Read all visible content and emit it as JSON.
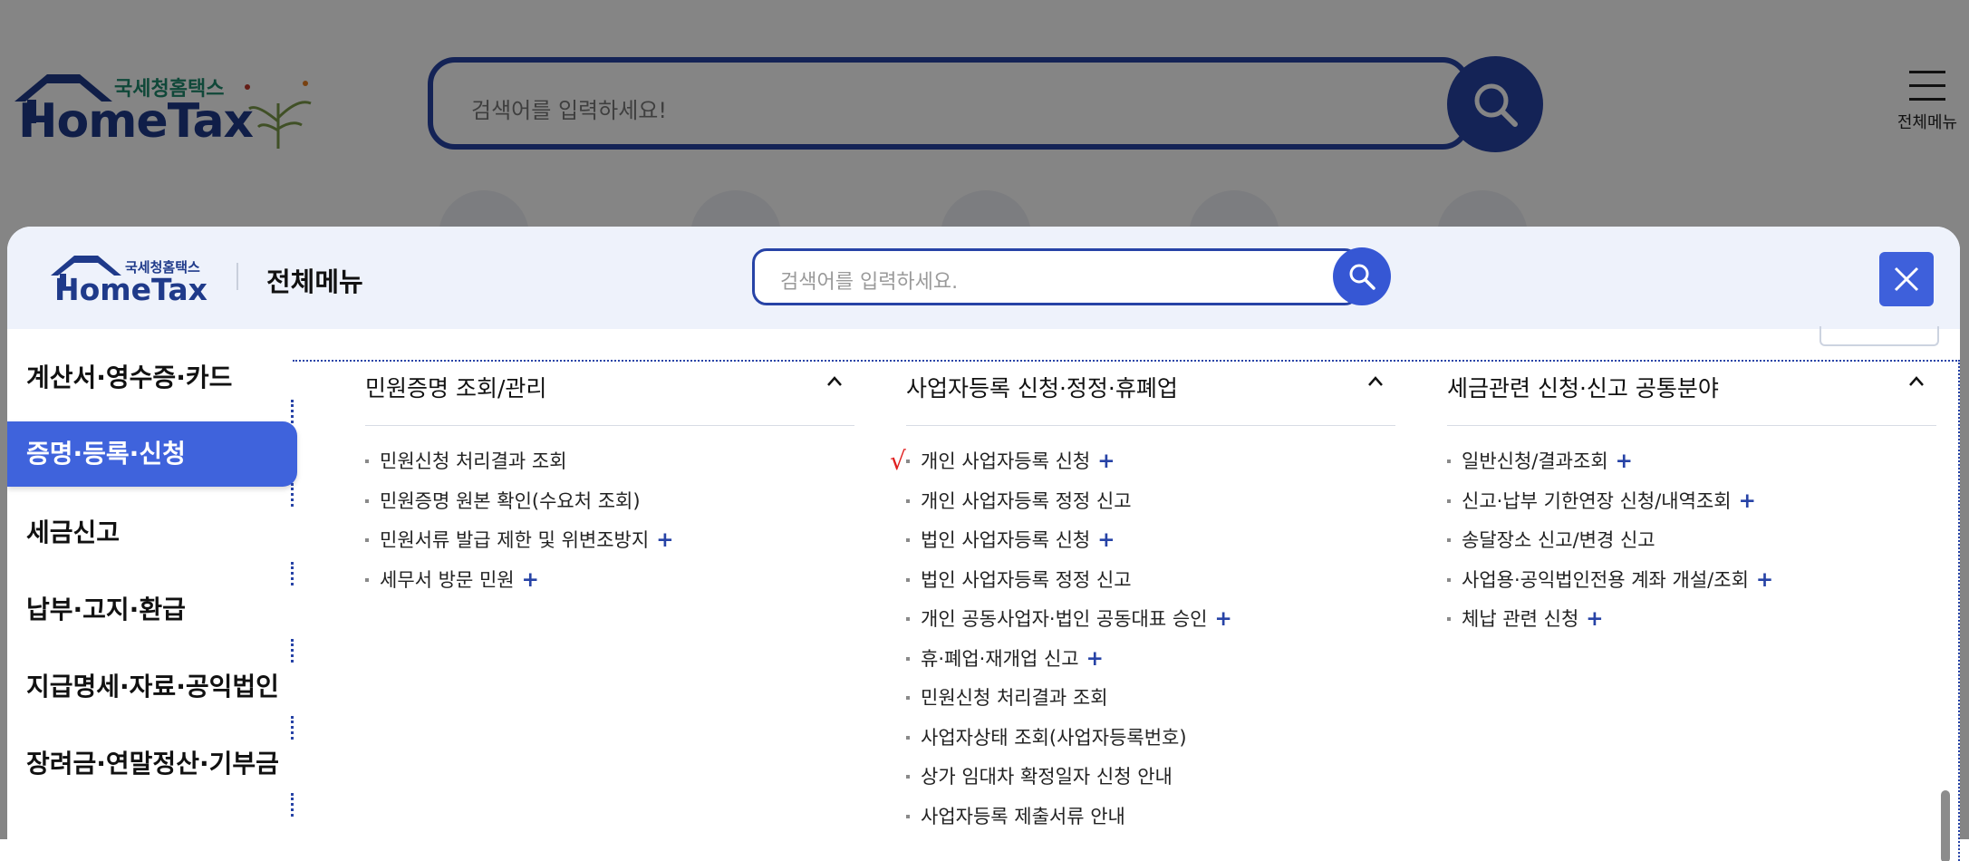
{
  "background": {
    "brand_kr": "국세청홈택스",
    "brand_en": "HomeTax",
    "search_placeholder": "검색어를 입력하세요!",
    "menu_label": "전체메뉴"
  },
  "modal": {
    "brand_kr": "국세청홈택스",
    "brand_en": "HomeTax",
    "title": "전체메뉴",
    "search_placeholder": "검색어를 입력하세요."
  },
  "sidebar": {
    "items": [
      {
        "label": "계산서·영수증·카드"
      },
      {
        "label": "증명·등록·신청",
        "active": true
      },
      {
        "label": "세금신고"
      },
      {
        "label": "납부·고지·환급"
      },
      {
        "label": "지급명세·자료·공익법인"
      },
      {
        "label": "장려금·연말정산·기부금"
      }
    ]
  },
  "columns": [
    {
      "title": "민원증명 조회/관리",
      "items": [
        {
          "label": "민원신청 처리결과 조회",
          "plus": false
        },
        {
          "label": "민원증명 원본 확인(수요처 조회)",
          "plus": false
        },
        {
          "label": "민원서류 발급 제한 및 위변조방지",
          "plus": true
        },
        {
          "label": "세무서 방문 민원",
          "plus": true
        }
      ]
    },
    {
      "title": "사업자등록 신청·정정·휴폐업",
      "items": [
        {
          "label": "개인 사업자등록 신청",
          "plus": true,
          "mark": "√"
        },
        {
          "label": "개인 사업자등록 정정 신고",
          "plus": false
        },
        {
          "label": "법인 사업자등록 신청",
          "plus": true
        },
        {
          "label": "법인 사업자등록 정정 신고",
          "plus": false
        },
        {
          "label": "개인 공동사업자·법인 공동대표 승인",
          "plus": true
        },
        {
          "label": "휴·폐업·재개업 신고",
          "plus": true
        },
        {
          "label": "민원신청 처리결과 조회",
          "plus": false
        },
        {
          "label": "사업자상태 조회(사업자등록번호)",
          "plus": false
        },
        {
          "label": "상가 임대차 확정일자 신청 안내",
          "plus": false
        },
        {
          "label": "사업자등록 제출서류 안내",
          "plus": false
        }
      ]
    },
    {
      "title": "세금관련 신청·신고 공통분야",
      "items": [
        {
          "label": "일반신청/결과조회",
          "plus": true
        },
        {
          "label": "신고·납부 기한연장 신청/내역조회",
          "plus": true
        },
        {
          "label": "송달장소 신고/변경 신고",
          "plus": false
        },
        {
          "label": "사업용·공익법인전용 계좌 개설/조회",
          "plus": true
        },
        {
          "label": "체납 관련 신청",
          "plus": true
        }
      ]
    }
  ],
  "plus_symbol": "+",
  "colors": {
    "accent": "#2743a6",
    "active_tab": "#3f63dc",
    "header_bg": "#eef2fb",
    "mark": "#e02020"
  }
}
